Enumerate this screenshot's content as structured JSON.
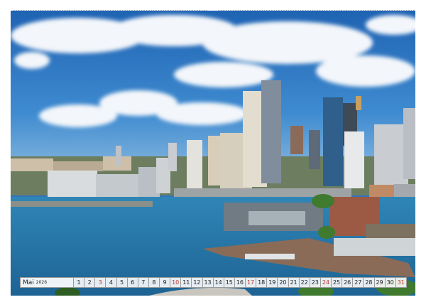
{
  "calendar": {
    "month": "Mai",
    "year": "2026",
    "days": [
      "1",
      "2",
      "3",
      "4",
      "5",
      "6",
      "7",
      "8",
      "9",
      "10",
      "11",
      "12",
      "13",
      "14",
      "15",
      "16",
      "17",
      "18",
      "19",
      "20",
      "21",
      "22",
      "23",
      "24",
      "25",
      "26",
      "27",
      "28",
      "29",
      "30",
      "31"
    ],
    "sunday_days": [
      "3",
      "10",
      "17",
      "24",
      "31"
    ],
    "sunday_color": "#c0392b"
  },
  "photo": {
    "sky_color": "#2f74bd",
    "water_color": "#2a79a8"
  }
}
